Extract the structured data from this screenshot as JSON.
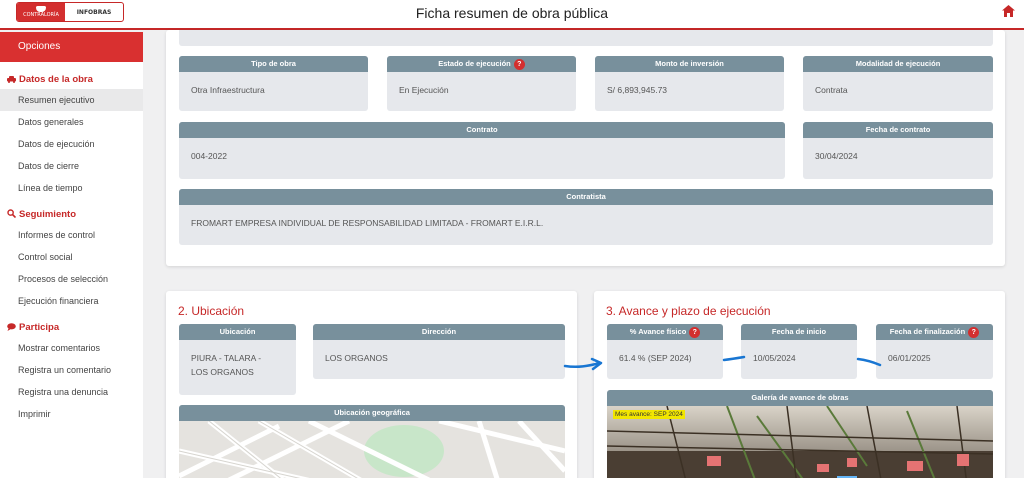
{
  "header": {
    "title": "Ficha resumen de obra pública",
    "logo_left": "CONTRALORÍA",
    "logo_right": "INFOBRAS",
    "home_icon": "home-icon"
  },
  "sidebar": {
    "heading": "Opciones",
    "sections": [
      {
        "title": "Datos de la obra",
        "icon": "car-icon",
        "items": [
          "Resumen ejecutivo",
          "Datos generales",
          "Datos de ejecución",
          "Datos de cierre",
          "Línea de tiempo"
        ]
      },
      {
        "title": "Seguimiento",
        "icon": "search-icon",
        "items": [
          "Informes de control",
          "Control social",
          "Procesos de selección",
          "Ejecución financiera"
        ]
      },
      {
        "title": "Participa",
        "icon": "chat-icon",
        "items": [
          "Mostrar comentarios",
          "Registra un comentario",
          "Registra una denuncia",
          "Imprimir"
        ]
      }
    ],
    "active_item": "Resumen ejecutivo"
  },
  "summary": {
    "tipo_obra": {
      "label": "Tipo de obra",
      "value": "Otra Infraestructura"
    },
    "estado": {
      "label": "Estado de ejecución",
      "value": "En Ejecución"
    },
    "monto": {
      "label": "Monto de inversión",
      "value": "S/ 6,893,945.73"
    },
    "modalidad": {
      "label": "Modalidad de ejecución",
      "value": "Contrata"
    },
    "contrato": {
      "label": "Contrato",
      "value": "004-2022"
    },
    "fecha_contrato": {
      "label": "Fecha de contrato",
      "value": "30/04/2024"
    },
    "contratista": {
      "label": "Contratista",
      "value": "FROMART EMPRESA INDIVIDUAL DE RESPONSABILIDAD LIMITADA - FROMART E.I.R.L."
    }
  },
  "ubicacion": {
    "title": "2. Ubicación",
    "ubicacion_label": "Ubicación",
    "ubicacion_line1": "PIURA - TALARA -",
    "ubicacion_line2": "LOS ORGANOS",
    "direccion_label": "Dirección",
    "direccion_value": "LOS ORGANOS",
    "geo_label": "Ubicación geográfica"
  },
  "avance": {
    "title": "3. Avance y plazo de ejecución",
    "fisico_label": "% Avance físico",
    "fisico_value": "61.4 % (SEP 2024)",
    "inicio_label": "Fecha de inicio",
    "inicio_value": "10/05/2024",
    "fin_label": "Fecha de finalización",
    "fin_value": "06/01/2025",
    "galeria_label": "Galería de avance de obras",
    "mes_avance": "Mes avance: SEP 2024"
  },
  "colors": {
    "brand_red": "#d32f2f",
    "field_header": "#78909c",
    "field_bg": "#e6e8ec",
    "annotation_blue": "#1976d2"
  }
}
